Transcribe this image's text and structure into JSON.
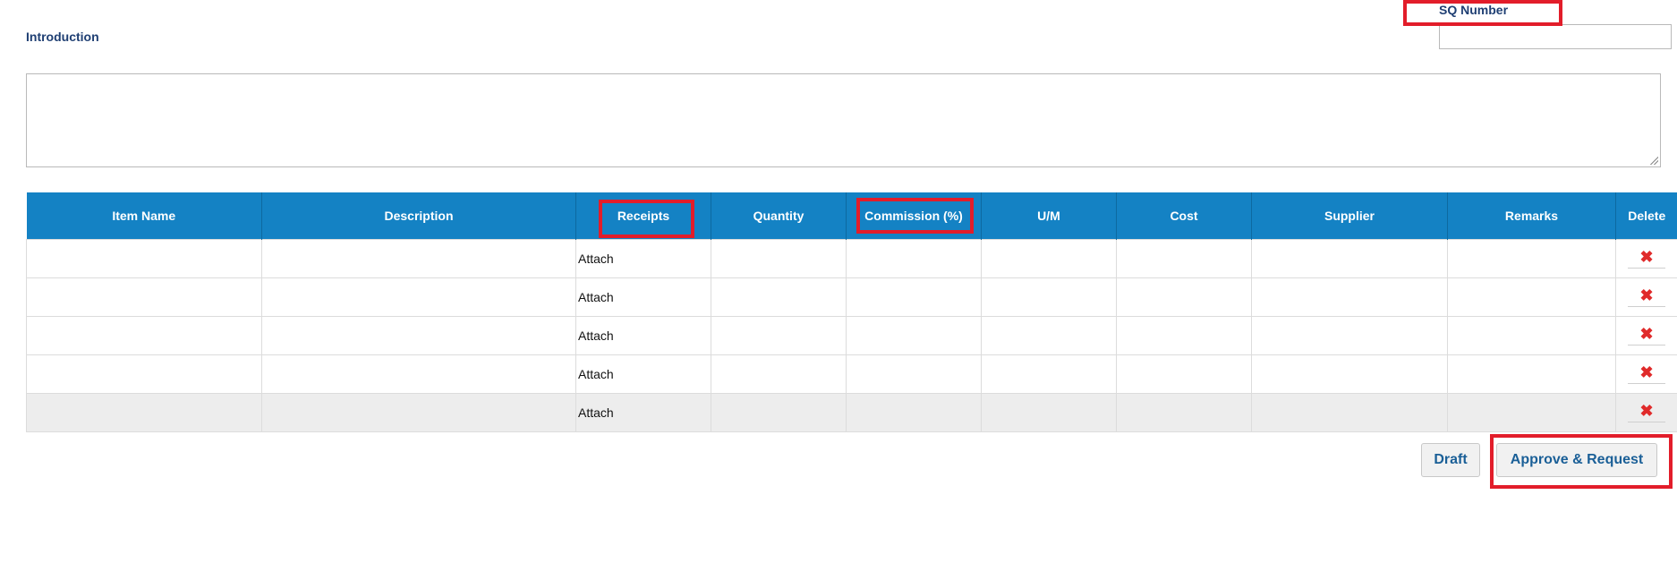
{
  "form": {
    "introduction_label": "Introduction",
    "sq_number_label": "SQ Number",
    "sq_number_value": "",
    "introduction_value": ""
  },
  "table": {
    "headers": [
      "Item Name",
      "Description",
      "Receipts",
      "Quantity",
      "Commission (%)",
      "U/M",
      "Cost",
      "Supplier",
      "Remarks",
      "Delete"
    ],
    "rows": [
      {
        "item_name": "",
        "description": "",
        "receipts": "Attach",
        "quantity": "",
        "commission": "",
        "um": "",
        "cost": "",
        "supplier": "",
        "remarks": "",
        "delete_icon": "close-icon"
      },
      {
        "item_name": "",
        "description": "",
        "receipts": "Attach",
        "quantity": "",
        "commission": "",
        "um": "",
        "cost": "",
        "supplier": "",
        "remarks": "",
        "delete_icon": "close-icon"
      },
      {
        "item_name": "",
        "description": "",
        "receipts": "Attach",
        "quantity": "",
        "commission": "",
        "um": "",
        "cost": "",
        "supplier": "",
        "remarks": "",
        "delete_icon": "close-icon"
      },
      {
        "item_name": "",
        "description": "",
        "receipts": "Attach",
        "quantity": "",
        "commission": "",
        "um": "",
        "cost": "",
        "supplier": "",
        "remarks": "",
        "delete_icon": "close-icon"
      },
      {
        "item_name": "",
        "description": "",
        "receipts": "Attach",
        "quantity": "",
        "commission": "",
        "um": "",
        "cost": "",
        "supplier": "",
        "remarks": "",
        "delete_icon": "close-icon"
      }
    ],
    "delete_glyph": "✖"
  },
  "actions": {
    "draft_label": "Draft",
    "approve_label": "Approve & Request"
  },
  "colors": {
    "header_bg": "#1482c4",
    "label_text": "#1f3f73",
    "button_text": "#1a5f97",
    "delete_icon": "#e02a2a",
    "highlight": "#e21d2a"
  }
}
